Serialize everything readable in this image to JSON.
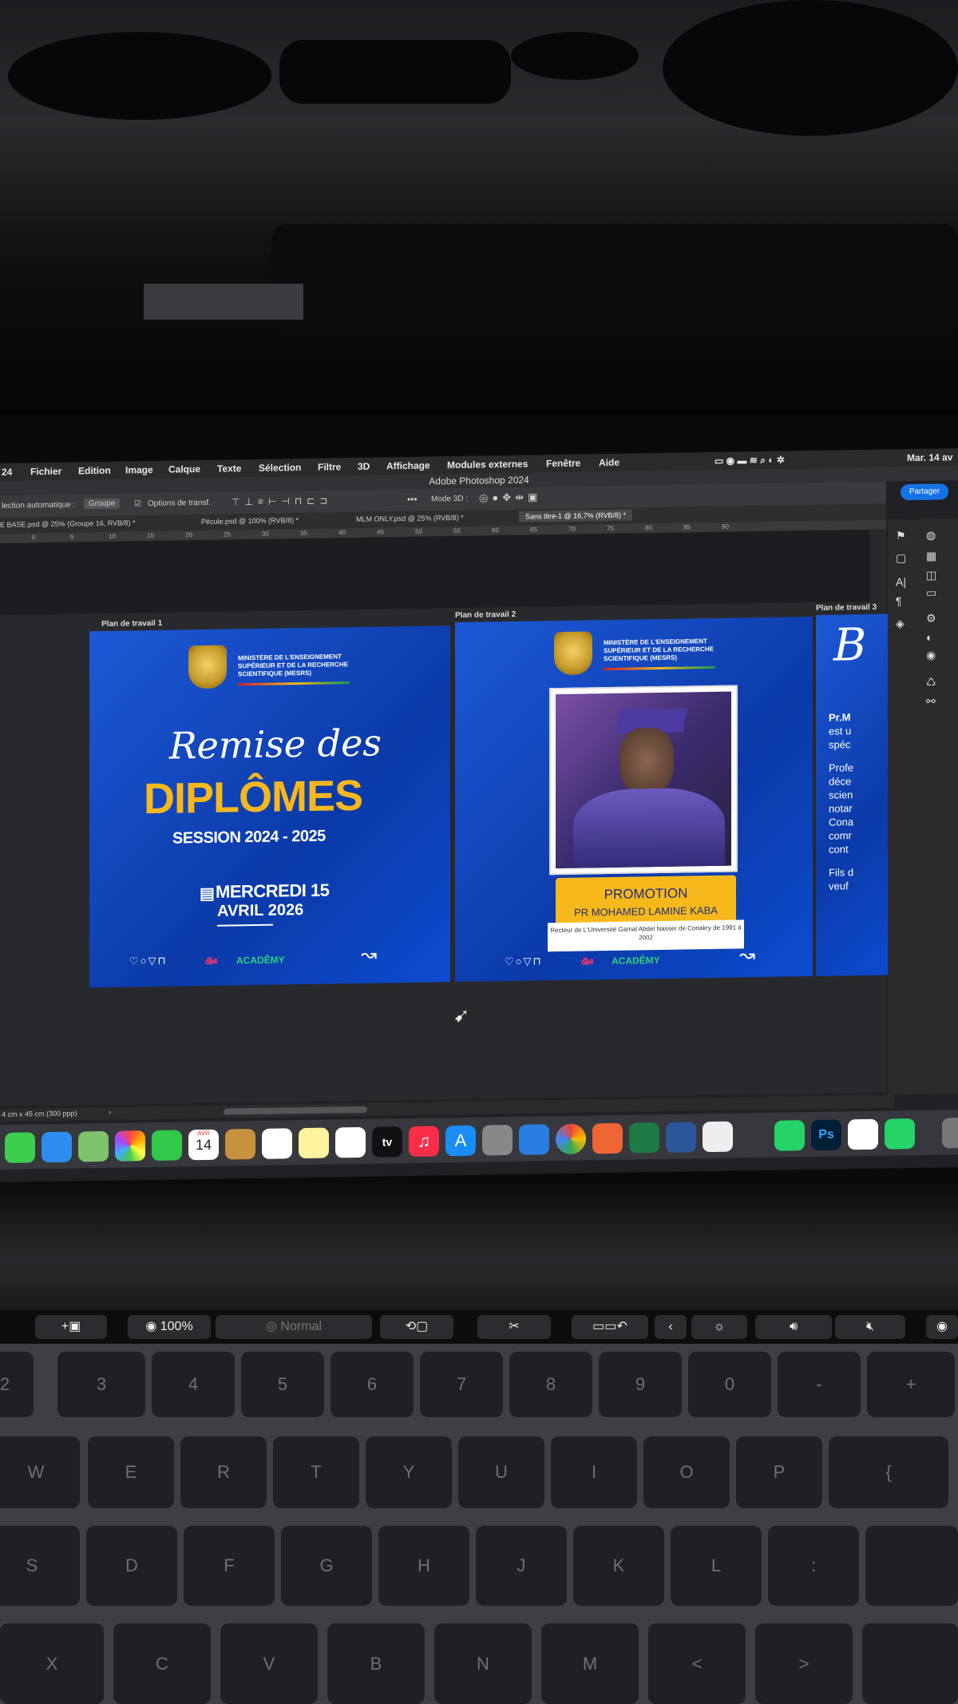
{
  "menubar": {
    "items": [
      "Fichier",
      "Edition",
      "Image",
      "Calque",
      "Texte",
      "Sélection",
      "Filtre",
      "3D",
      "Affichage",
      "Modules externes",
      "Fenêtre",
      "Aide"
    ],
    "app_prefix": "24",
    "clock": "Mar. 14 av"
  },
  "title": "Adobe Photoshop 2024",
  "options_bar": {
    "left_label": "lection automatique :",
    "select_value": "Groupe",
    "transform_label": "Options de transf.",
    "mode3d_label": "Mode 3D :",
    "share_label": "Partager"
  },
  "tabs": [
    "E BASE.psd @ 25% (Groupe 16, RVB/8) *",
    "Pécule.psd @ 100% (RVB/8) *",
    "MLM ONLY.psd @ 25% (RVB/8) *",
    "Sans titre-1 @ 16,7% (RVB/8) *"
  ],
  "ruler_ticks": [
    "0",
    "5",
    "10",
    "15",
    "20",
    "25",
    "30",
    "35",
    "40",
    "45",
    "50",
    "55",
    "60",
    "65",
    "70",
    "75",
    "80",
    "85",
    "90"
  ],
  "artboards": {
    "a1": {
      "label": "Plan de travail 1",
      "ministry": "MINISTÈRE DE L'ENSEIGNEMENT SUPÉRIEUR ET DE LA RECHERCHE SCIENTIFIQUE (MESRS)",
      "script_title": "Remise des",
      "big_title": "DIPLÔMES",
      "session": "SESSION 2024 - 2025",
      "date_line1": "MERCREDI 15",
      "date_line2": "AVRIL 2026",
      "social_icons": "♡○▽⊓",
      "brand": "ACADÊMY"
    },
    "a2": {
      "label": "Plan de travail 2",
      "ministry": "MINISTÈRE DE L'ENSEIGNEMENT SUPÉRIEUR ET DE LA RECHERCHE SCIENTIFIQUE (MESRS)",
      "promotion": "PROMOTION",
      "name": "PR MOHAMED LAMINE KABA",
      "caption": "Recteur de L'Université Gamal Abdel Nasser de Conakry de 1991 à 2002",
      "social_icons": "♡○▽⊓",
      "brand": "ACADÊMY"
    },
    "a3": {
      "label": "Plan de travail 3",
      "big_letter": "B",
      "lines": [
        "Pr.M",
        "est u",
        "spéc",
        "Profe",
        "déce",
        "scien",
        "notar",
        "Cona",
        "comr",
        "cont",
        "Fils d",
        "veuf"
      ]
    }
  },
  "statusbar": {
    "size": "4 cm x 45 cm (300 ppp)"
  },
  "dock": {
    "calendar_month": "AVR",
    "calendar_day": "14",
    "tv_label": "tv",
    "ps_label": "Ps"
  },
  "touchbar": {
    "zoom": "100%",
    "mode": "Normal"
  },
  "keyboard": {
    "row1": [
      "2",
      "3",
      "4",
      "5",
      "6",
      "7",
      "8",
      "9",
      "0",
      "-",
      "+"
    ],
    "row2": [
      "W",
      "E",
      "R",
      "T",
      "Y",
      "U",
      "I",
      "O",
      "P",
      "{"
    ],
    "row3": [
      "S",
      "D",
      "F",
      "G",
      "H",
      "J",
      "K",
      "L",
      ":"
    ],
    "row4": [
      "X",
      "C",
      "V",
      "B",
      "N",
      "M",
      "<",
      ">"
    ]
  }
}
